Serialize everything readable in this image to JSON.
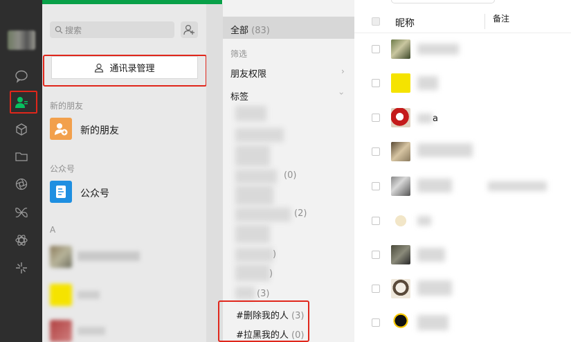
{
  "sidebar": {
    "icons": [
      "chat-icon",
      "contacts-icon",
      "cube-icon",
      "folder-icon",
      "aperture-icon",
      "butterfly-icon",
      "atom-icon",
      "sparkle-icon"
    ]
  },
  "contacts_panel": {
    "search_placeholder": "搜索",
    "manage_button": "通讯录管理",
    "new_friends_section": "新的朋友",
    "new_friends_label": "新的朋友",
    "public_section": "公众号",
    "public_label": "公众号",
    "letter_a": "A"
  },
  "filter_panel": {
    "all_label": "全部",
    "all_count": "(83)",
    "filter_heading": "筛选",
    "friend_permission": "朋友权限",
    "tags_label": "标签",
    "partial_counts": [
      "(0)",
      "(2)",
      ")",
      ")",
      "(3)"
    ],
    "tag_deleted_me": "#删除我的人",
    "tag_deleted_me_count": "(3)",
    "tag_blocked_me": "#拉黑我的人",
    "tag_blocked_me_count": "(0)"
  },
  "contact_list": {
    "col_nickname": "昵称",
    "col_remark": "备注",
    "partial_names": [
      "a"
    ]
  },
  "colors": {
    "rail_bg": "#2e2e2e",
    "accent_green": "#08a048",
    "highlight_red": "#e0261b"
  }
}
